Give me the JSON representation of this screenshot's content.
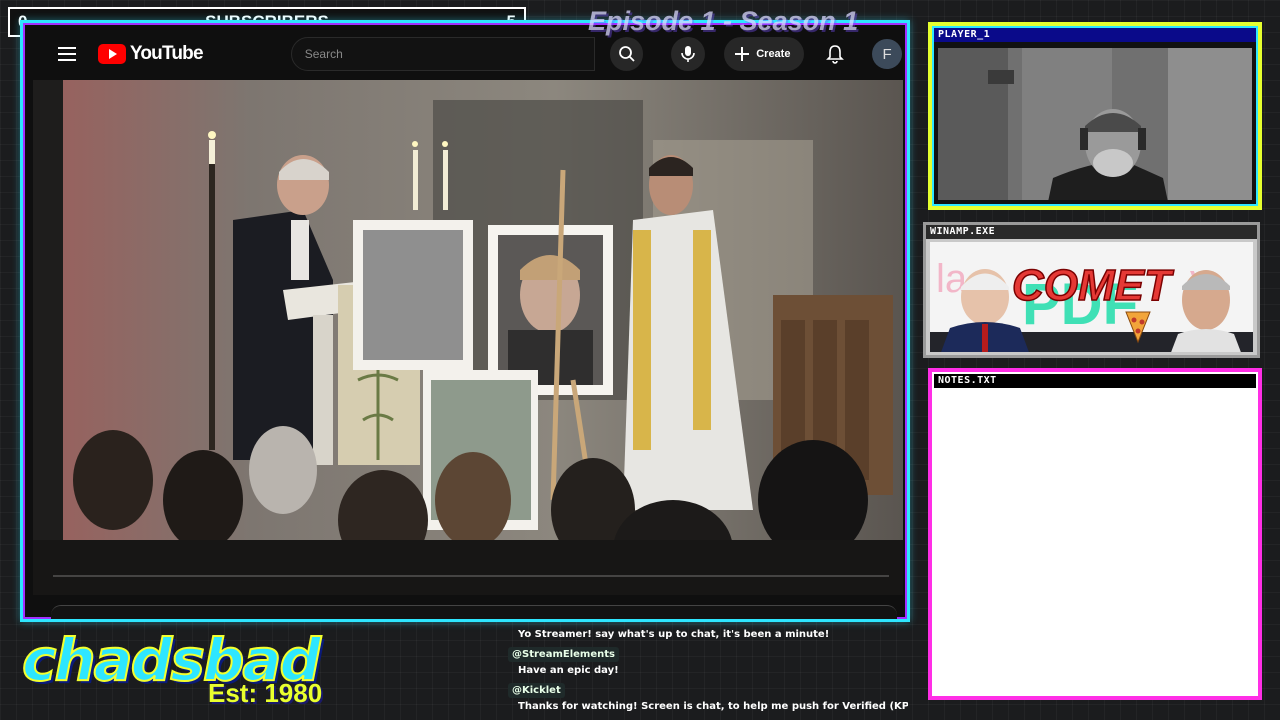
{
  "subscriber_bar": {
    "left_count": "0",
    "label": "SUBSCRIBERS",
    "right_count": "5"
  },
  "episode_title": "Episode 1 - Season 1",
  "youtube": {
    "logo_text": "YouTube",
    "search_placeholder": "Search",
    "create_label": "Create",
    "avatar_letter": "F"
  },
  "panels": {
    "player": "PLAYER_1",
    "winamp": "WINAMP.EXE",
    "notes": "NOTES.TXT"
  },
  "winamp_art": {
    "headline": "COMET",
    "letters": "PDF"
  },
  "logo": {
    "name": "chadsbad",
    "est": "Est: 1980"
  },
  "chat": [
    {
      "type": "message",
      "text": "Yo Streamer! say what's up to chat, it's been a minute!"
    },
    {
      "type": "user",
      "text": "@StreamElements"
    },
    {
      "type": "message",
      "text": "Have an epic day!"
    },
    {
      "type": "user",
      "text": "@Kicklet"
    },
    {
      "type": "message",
      "text": "Thanks for watching! Screen is chat, to help me push for Verified (KPP"
    }
  ],
  "colors": {
    "frame_cyan": "#2ee6ff",
    "frame_purple": "#a230ff",
    "player_border": "#e5ff2e",
    "notes_border": "#ff2ee6",
    "youtube_red": "#ff0000"
  }
}
